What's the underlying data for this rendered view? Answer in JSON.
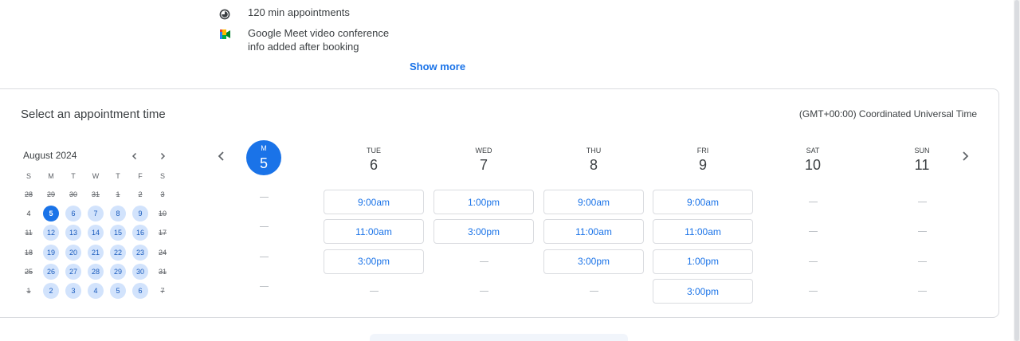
{
  "info": {
    "duration": "120 min appointments",
    "meet_line1": "Google Meet video conference",
    "meet_line2": "info added after booking",
    "show_more": "Show more"
  },
  "card": {
    "title": "Select an appointment time",
    "timezone": "(GMT+00:00) Coordinated Universal Time"
  },
  "mini_calendar": {
    "month_label": "August 2024",
    "prev_icon": "chevron-left-icon",
    "next_icon": "chevron-right-icon",
    "dow": [
      "S",
      "M",
      "T",
      "W",
      "T",
      "F",
      "S"
    ],
    "weeks": [
      [
        {
          "d": "28",
          "s": "unavail"
        },
        {
          "d": "29",
          "s": "unavail"
        },
        {
          "d": "30",
          "s": "unavail"
        },
        {
          "d": "31",
          "s": "unavail"
        },
        {
          "d": "1",
          "s": "unavail"
        },
        {
          "d": "2",
          "s": "unavail"
        },
        {
          "d": "3",
          "s": "unavail"
        }
      ],
      [
        {
          "d": "4",
          "s": "plain"
        },
        {
          "d": "5",
          "s": "selected"
        },
        {
          "d": "6",
          "s": "avail"
        },
        {
          "d": "7",
          "s": "avail"
        },
        {
          "d": "8",
          "s": "avail"
        },
        {
          "d": "9",
          "s": "avail"
        },
        {
          "d": "10",
          "s": "unavail"
        }
      ],
      [
        {
          "d": "11",
          "s": "unavail"
        },
        {
          "d": "12",
          "s": "avail"
        },
        {
          "d": "13",
          "s": "avail"
        },
        {
          "d": "14",
          "s": "avail"
        },
        {
          "d": "15",
          "s": "avail"
        },
        {
          "d": "16",
          "s": "avail"
        },
        {
          "d": "17",
          "s": "unavail"
        }
      ],
      [
        {
          "d": "18",
          "s": "unavail"
        },
        {
          "d": "19",
          "s": "avail"
        },
        {
          "d": "20",
          "s": "avail"
        },
        {
          "d": "21",
          "s": "avail"
        },
        {
          "d": "22",
          "s": "avail"
        },
        {
          "d": "23",
          "s": "avail"
        },
        {
          "d": "24",
          "s": "unavail"
        }
      ],
      [
        {
          "d": "25",
          "s": "unavail"
        },
        {
          "d": "26",
          "s": "avail"
        },
        {
          "d": "27",
          "s": "avail"
        },
        {
          "d": "28",
          "s": "avail"
        },
        {
          "d": "29",
          "s": "avail"
        },
        {
          "d": "30",
          "s": "avail"
        },
        {
          "d": "31",
          "s": "unavail"
        }
      ],
      [
        {
          "d": "1",
          "s": "unavail"
        },
        {
          "d": "2",
          "s": "avail"
        },
        {
          "d": "3",
          "s": "avail"
        },
        {
          "d": "4",
          "s": "avail"
        },
        {
          "d": "5",
          "s": "avail"
        },
        {
          "d": "6",
          "s": "avail"
        },
        {
          "d": "7",
          "s": "unavail"
        }
      ]
    ]
  },
  "week_view": {
    "prev_icon": "chevron-left-icon",
    "next_icon": "chevron-right-icon",
    "days": [
      {
        "name": "M",
        "num": "5",
        "selected": true,
        "slots": [
          null,
          null,
          null,
          null
        ]
      },
      {
        "name": "TUE",
        "num": "6",
        "selected": false,
        "slots": [
          "9:00am",
          "11:00am",
          "3:00pm",
          null
        ]
      },
      {
        "name": "WED",
        "num": "7",
        "selected": false,
        "slots": [
          "1:00pm",
          "3:00pm",
          null,
          null
        ]
      },
      {
        "name": "THU",
        "num": "8",
        "selected": false,
        "slots": [
          "9:00am",
          "11:00am",
          "3:00pm",
          null
        ]
      },
      {
        "name": "FRI",
        "num": "9",
        "selected": false,
        "slots": [
          "9:00am",
          "11:00am",
          "1:00pm",
          "3:00pm"
        ]
      },
      {
        "name": "SAT",
        "num": "10",
        "selected": false,
        "slots": [
          null,
          null,
          null,
          null
        ]
      },
      {
        "name": "SUN",
        "num": "11",
        "selected": false,
        "slots": [
          null,
          null,
          null,
          null
        ]
      }
    ]
  },
  "colors": {
    "accent": "#1a73e8",
    "available_day_bg": "#d2e3fc",
    "border": "#dadce0"
  }
}
